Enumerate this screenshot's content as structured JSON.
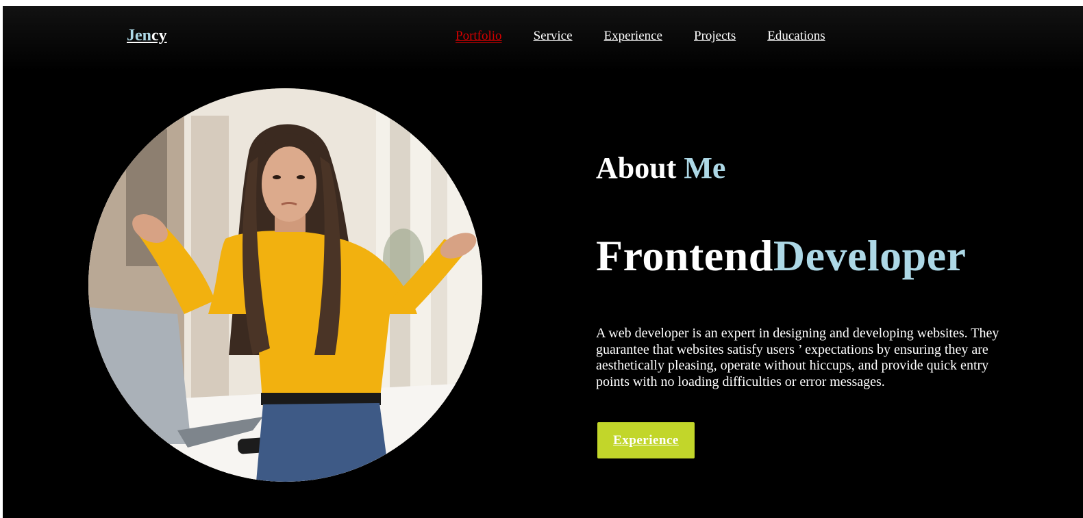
{
  "brand": {
    "part1": "Jen",
    "part2": "cy"
  },
  "nav": {
    "items": [
      {
        "label": "Portfolio",
        "active": true
      },
      {
        "label": "Service",
        "active": false
      },
      {
        "label": "Experience",
        "active": false
      },
      {
        "label": "Projects",
        "active": false
      },
      {
        "label": "Educations",
        "active": false
      }
    ]
  },
  "hero": {
    "about_word1": "About",
    "about_word2": "Me",
    "role_word1": "Frontend",
    "role_word2": "Developer",
    "description": "A web developer is an expert in designing and developing websites. They guarantee that websites satisfy users ’ expectations by ensuring they are aesthetically pleasing, operate without hiccups, and provide quick entry points with no loading difficulties or error messages.",
    "cta_label": "Experience"
  },
  "colors": {
    "background": "#000000",
    "accent": "#add8e6",
    "active_nav": "#d60000",
    "button": "#c2d62a"
  },
  "image": {
    "subject": "profile-photo"
  }
}
